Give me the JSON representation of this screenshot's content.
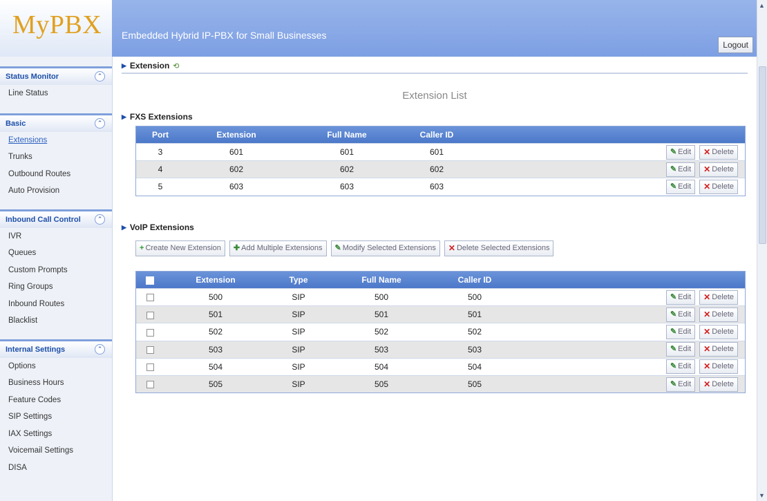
{
  "app": {
    "logo": "MyPBX",
    "subtitle": "Embedded Hybrid IP-PBX for Small Businesses",
    "logout_label": "Logout"
  },
  "sidebar": {
    "groups": [
      {
        "title": "Status Monitor",
        "items": [
          "Line Status"
        ]
      },
      {
        "title": "Basic",
        "items": [
          "Extensions",
          "Trunks",
          "Outbound Routes",
          "Auto Provision"
        ]
      },
      {
        "title": "Inbound Call Control",
        "items": [
          "IVR",
          "Queues",
          "Custom Prompts",
          "Ring Groups",
          "Inbound Routes",
          "Blacklist"
        ]
      },
      {
        "title": "Internal Settings",
        "items": [
          "Options",
          "Business Hours",
          "Feature Codes",
          "SIP Settings",
          "IAX Settings",
          "Voicemail Settings",
          "DISA"
        ]
      }
    ],
    "active_item": "Extensions"
  },
  "breadcrumb": {
    "label": "Extension"
  },
  "page": {
    "title": "Extension List"
  },
  "fxs": {
    "title": "FXS Extensions",
    "columns": [
      "Port",
      "Extension",
      "Full Name",
      "Caller ID"
    ],
    "rows": [
      [
        "3",
        "601",
        "601",
        "601"
      ],
      [
        "4",
        "602",
        "602",
        "602"
      ],
      [
        "5",
        "603",
        "603",
        "603"
      ]
    ]
  },
  "voip": {
    "title": "VoIP Extensions",
    "toolbar": {
      "create": "Create New Extension",
      "add_multiple": "Add Multiple Extensions",
      "modify_selected": "Modify Selected Extensions",
      "delete_selected": "Delete Selected Extensions"
    },
    "columns": [
      "Extension",
      "Type",
      "Full Name",
      "Caller ID"
    ],
    "rows": [
      [
        "500",
        "SIP",
        "500",
        "500"
      ],
      [
        "501",
        "SIP",
        "501",
        "501"
      ],
      [
        "502",
        "SIP",
        "502",
        "502"
      ],
      [
        "503",
        "SIP",
        "503",
        "503"
      ],
      [
        "504",
        "SIP",
        "504",
        "504"
      ],
      [
        "505",
        "SIP",
        "505",
        "505"
      ]
    ]
  },
  "actions": {
    "edit": "Edit",
    "delete": "Delete"
  }
}
